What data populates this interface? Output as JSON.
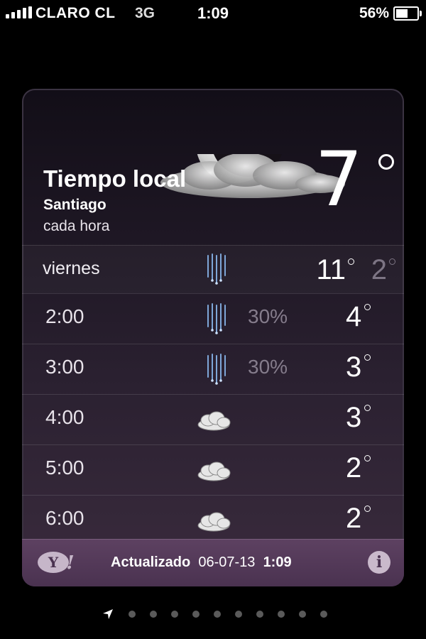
{
  "status_bar": {
    "carrier": "CLARO CL",
    "network": "3G",
    "time": "1:09",
    "battery_percent": "56%",
    "battery_level": 0.56
  },
  "header": {
    "title": "Tiempo local",
    "city": "Santiago",
    "subtitle": "cada hora",
    "current_temp": "7",
    "condition_icon": "moon-cloud-icon"
  },
  "day": {
    "label": "viernes",
    "icon": "rain-icon",
    "high": "11",
    "low": "2"
  },
  "hours": [
    {
      "time": "2:00",
      "icon": "rain-icon",
      "pop": "30%",
      "temp": "4"
    },
    {
      "time": "3:00",
      "icon": "rain-icon",
      "pop": "30%",
      "temp": "3"
    },
    {
      "time": "4:00",
      "icon": "cloud-icon",
      "pop": "",
      "temp": "3"
    },
    {
      "time": "5:00",
      "icon": "cloud-icon",
      "pop": "",
      "temp": "2"
    },
    {
      "time": "6:00",
      "icon": "cloud-icon",
      "pop": "",
      "temp": "2"
    }
  ],
  "footer": {
    "updated_label": "Actualizado",
    "updated_date": "06-07-13",
    "updated_time": "1:09",
    "logo": "yahoo-logo",
    "info_icon": "info-icon"
  },
  "pager": {
    "total": 11,
    "current": 0,
    "first_icon": "location-arrow-icon"
  }
}
